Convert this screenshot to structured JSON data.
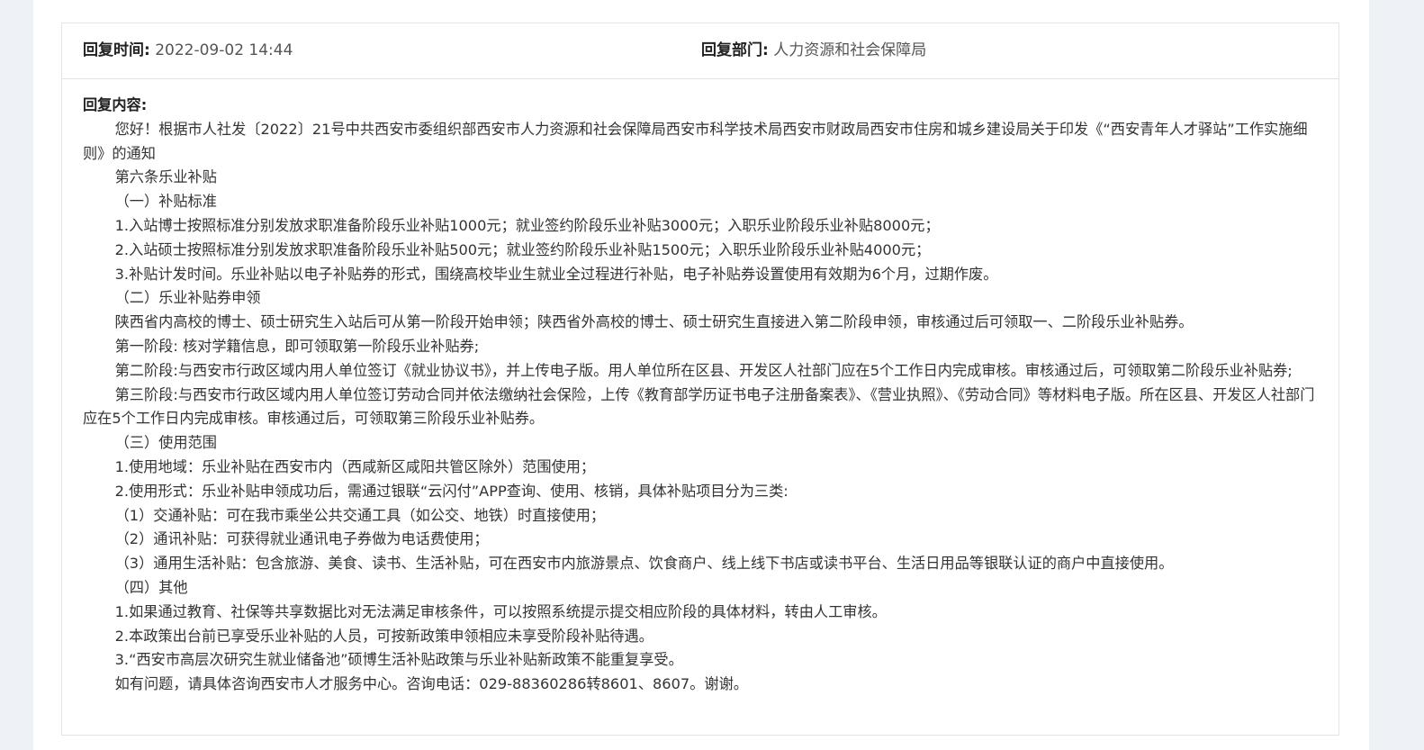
{
  "reply": {
    "time_label": "回复时间:",
    "time_value": "2022-09-02 14:44",
    "dept_label": "回复部门:",
    "dept_value": "人力资源和社会保障局",
    "content_label": "回复内容:",
    "paragraphs": [
      "您好！根据市人社发〔2022〕21号中共西安市委组织部西安市人力资源和社会保障局西安市科学技术局西安市财政局西安市住房和城乡建设局关于印发《“西安青年人才驿站”工作实施细则》的通知",
      "第六条乐业补贴",
      "（一）补贴标准",
      "1.入站博士按照标准分别发放求职准备阶段乐业补贴1000元；就业签约阶段乐业补贴3000元；入职乐业阶段乐业补贴8000元；",
      "2.入站硕士按照标准分别发放求职准备阶段乐业补贴500元；就业签约阶段乐业补贴1500元；入职乐业阶段乐业补贴4000元；",
      "3.补贴计发时间。乐业补贴以电子补贴券的形式，围绕高校毕业生就业全过程进行补贴，电子补贴券设置使用有效期为6个月，过期作废。",
      "（二）乐业补贴券申领",
      "陕西省内高校的博士、硕士研究生入站后可从第一阶段开始申领；陕西省外高校的博士、硕士研究生直接进入第二阶段申领，审核通过后可领取一、二阶段乐业补贴券。",
      "第一阶段: 核对学籍信息，即可领取第一阶段乐业补贴券;",
      "第二阶段:与西安市行政区域内用人单位签订《就业协议书》，并上传电子版。用人单位所在区县、开发区人社部门应在5个工作日内完成审核。审核通过后，可领取第二阶段乐业补贴券;",
      "第三阶段:与西安市行政区域内用人单位签订劳动合同并依法缴纳社会保险，上传《教育部学历证书电子注册备案表》、《营业执照》、《劳动合同》等材料电子版。所在区县、开发区人社部门应在5个工作日内完成审核。审核通过后，可领取第三阶段乐业补贴券。",
      "（三）使用范围",
      "1.使用地域：乐业补贴在西安市内（西咸新区咸阳共管区除外）范围使用；",
      "2.使用形式：乐业补贴申领成功后，需通过银联“云闪付”APP查询、使用、核销，具体补贴项目分为三类:",
      "（1）交通补贴：可在我市乘坐公共交通工具（如公交、地铁）时直接使用；",
      "（2）通讯补贴：可获得就业通讯电子券做为电话费使用；",
      "（3）通用生活补贴：包含旅游、美食、读书、生活补贴，可在西安市内旅游景点、饮食商户、线上线下书店或读书平台、生活日用品等银联认证的商户中直接使用。",
      "（四）其他",
      "1.如果通过教育、社保等共享数据比对无法满足审核条件，可以按照系统提示提交相应阶段的具体材料，转由人工审核。",
      "2.本政策出台前已享受乐业补贴的人员，可按新政策申领相应未享受阶段补贴待遇。",
      "3.“西安市高层次研究生就业储备池”硕博生活补贴政策与乐业补贴新政策不能重复享受。",
      "如有问题，请具体咨询西安市人才服务中心。咨询电话：029-88360286转8601、8607。谢谢。"
    ]
  }
}
